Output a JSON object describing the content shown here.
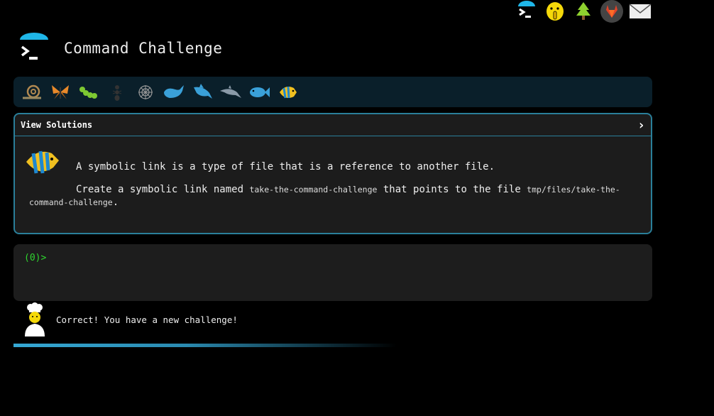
{
  "app": {
    "title": "Command Challenge"
  },
  "topbar": {
    "icons": [
      "terminal-icon",
      "shushing-face-icon",
      "tree-icon",
      "gitlab-icon",
      "envelope-icon"
    ]
  },
  "levels": [
    "snail-icon",
    "butterfly-icon",
    "caterpillar-icon",
    "ant-icon",
    "spider-web-icon",
    "whale-icon",
    "shark-icon",
    "dolphin-icon",
    "fish-icon",
    "tropical-fish-icon"
  ],
  "challenge": {
    "solutions_label": "View Solutions",
    "chevron": "›",
    "intro": "A symbolic link is a type of file that is a reference to another file.",
    "task_prefix": "Create a symbolic link named ",
    "link_name": "take-the-command-challenge",
    "task_middle": " that points to the file ",
    "target_path": "tmp/files/take-the-command-challenge",
    "task_suffix": "."
  },
  "terminal": {
    "prompt": "(0)>",
    "input": ""
  },
  "feedback": {
    "message": "Correct! You have a new challenge!",
    "progress": 0.6
  },
  "colors": {
    "accent": "#2a7f9a",
    "prompt": "#2fd62f",
    "progress": "#35a8d4"
  }
}
